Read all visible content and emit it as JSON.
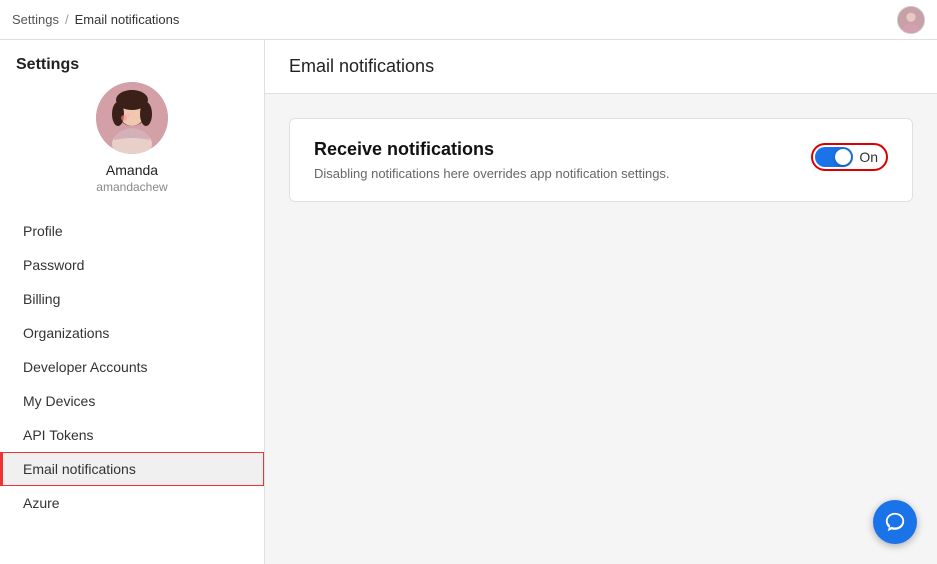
{
  "topbar": {
    "breadcrumb_root": "Settings",
    "breadcrumb_sep": "/",
    "breadcrumb_current": "Email notifications"
  },
  "sidebar": {
    "title": "Settings",
    "profile": {
      "name": "Amanda",
      "username": "amandachew"
    },
    "nav_items": [
      {
        "id": "profile",
        "label": "Profile",
        "active": false
      },
      {
        "id": "password",
        "label": "Password",
        "active": false
      },
      {
        "id": "billing",
        "label": "Billing",
        "active": false
      },
      {
        "id": "organizations",
        "label": "Organizations",
        "active": false
      },
      {
        "id": "developer-accounts",
        "label": "Developer Accounts",
        "active": false
      },
      {
        "id": "my-devices",
        "label": "My Devices",
        "active": false
      },
      {
        "id": "api-tokens",
        "label": "API Tokens",
        "active": false
      },
      {
        "id": "email-notifications",
        "label": "Email notifications",
        "active": true
      },
      {
        "id": "azure",
        "label": "Azure",
        "active": false
      }
    ]
  },
  "main": {
    "header": "Email notifications",
    "card": {
      "title": "Receive notifications",
      "subtitle": "Disabling notifications here overrides app notification settings.",
      "toggle_state": "On",
      "toggle_on": true
    }
  }
}
